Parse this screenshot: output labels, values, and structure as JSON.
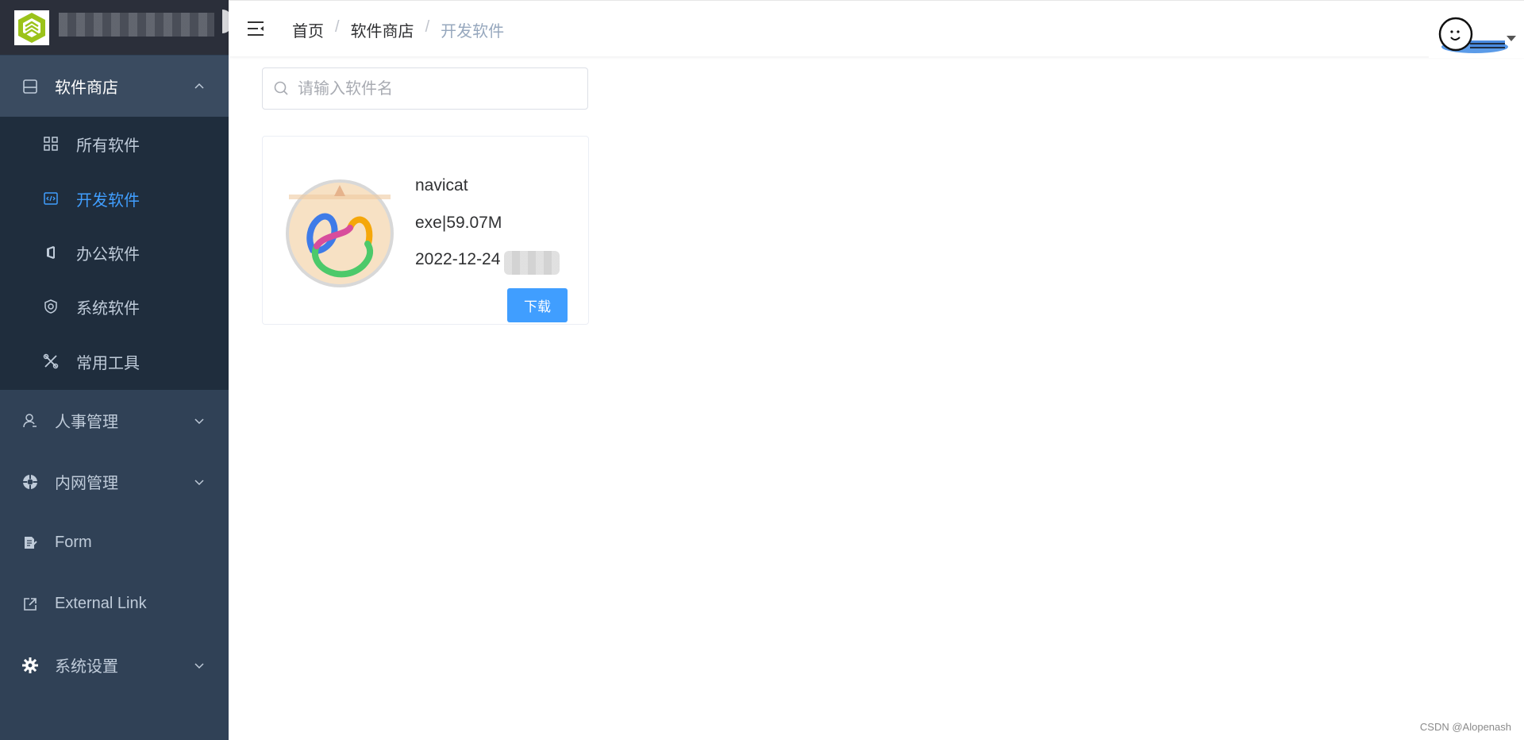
{
  "sidebar": {
    "menu": [
      {
        "label": "软件商店",
        "icon": "store-icon",
        "expanded": true
      },
      {
        "label": "人事管理",
        "icon": "user-icon",
        "expanded": false
      },
      {
        "label": "内网管理",
        "icon": "network-icon",
        "expanded": false
      },
      {
        "label": "Form",
        "icon": "form-icon"
      },
      {
        "label": "External Link",
        "icon": "external-link-icon"
      },
      {
        "label": "系统设置",
        "icon": "gear-icon",
        "expanded": false
      }
    ],
    "submenu": [
      {
        "label": "所有软件",
        "icon": "grid-icon"
      },
      {
        "label": "开发软件",
        "icon": "code-icon",
        "active": true
      },
      {
        "label": "办公软件",
        "icon": "office-icon"
      },
      {
        "label": "系统软件",
        "icon": "shield-icon"
      },
      {
        "label": "常用工具",
        "icon": "tools-icon"
      }
    ]
  },
  "header": {
    "breadcrumb": [
      "首页",
      "软件商店",
      "开发软件"
    ],
    "separator": "/"
  },
  "search": {
    "placeholder": "请输入软件名",
    "value": ""
  },
  "apps": [
    {
      "name": "navicat",
      "meta": "exe|59.07M",
      "date": "2022-12-24",
      "button_label": "下载"
    }
  ],
  "watermark": "CSDN @Alopenash",
  "colors": {
    "sidebar_bg": "#304156",
    "submenu_bg": "#1f2d3d",
    "active": "#409eff",
    "primary_button": "#409eff"
  }
}
